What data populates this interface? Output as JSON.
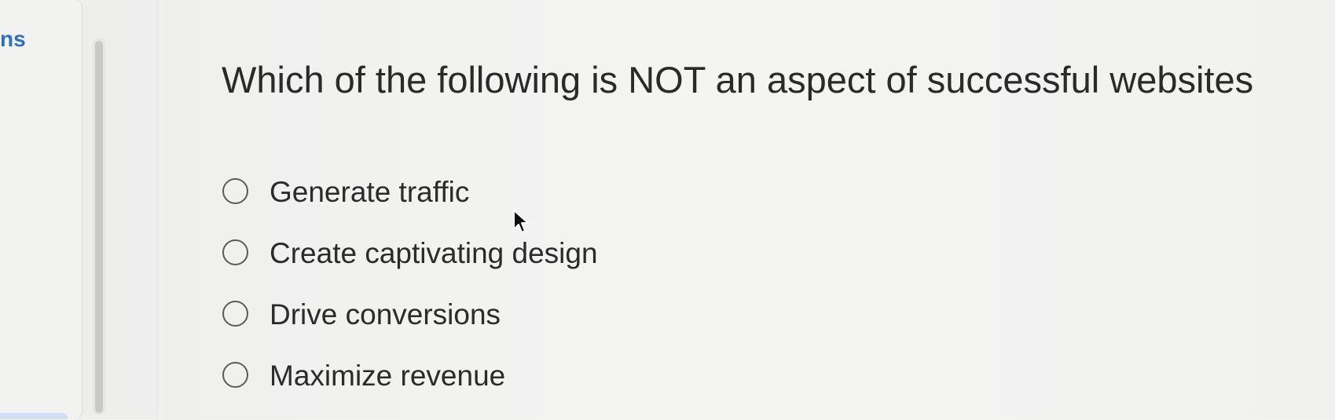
{
  "sidebar": {
    "label": "ns"
  },
  "question": {
    "text": "Which of the following is NOT an aspect of successful websites"
  },
  "options": [
    {
      "label": "Generate traffic",
      "selected": false
    },
    {
      "label": "Create captivating design",
      "selected": false
    },
    {
      "label": "Drive conversions",
      "selected": false
    },
    {
      "label": "Maximize revenue",
      "selected": false
    }
  ],
  "cursor": {
    "icon": "arrow-pointer-icon"
  }
}
